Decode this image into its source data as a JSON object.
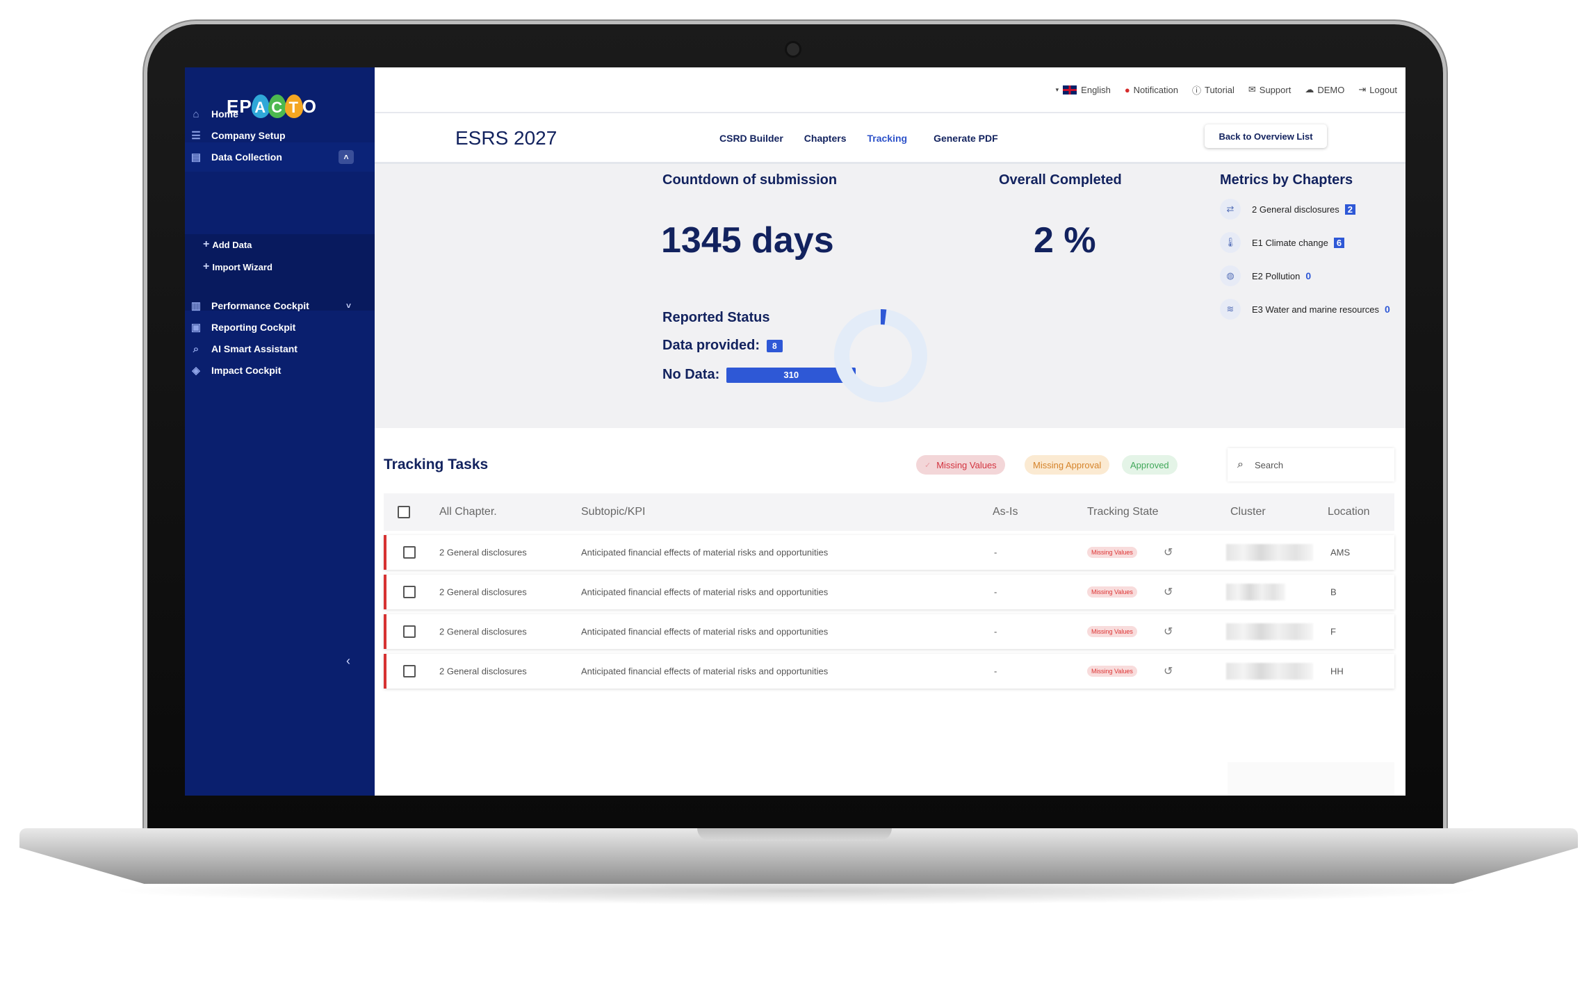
{
  "app": {
    "logo_text": "EPACTO",
    "logo_parts": [
      "EP",
      "A",
      "C",
      "T",
      "O"
    ],
    "colors": {
      "sidebar": "#0a1f6e",
      "accent": "#2e58d6",
      "missing": "#d3333f",
      "approval": "#d5832a",
      "approved": "#41a85a"
    }
  },
  "sidebar": {
    "items": [
      {
        "label": "Home",
        "icon": "home-icon"
      },
      {
        "label": "Company Setup",
        "icon": "list-icon"
      },
      {
        "label": "Data Collection",
        "icon": "database-icon"
      },
      {
        "label": "Performance Cockpit",
        "icon": "chart-icon"
      },
      {
        "label": "Reporting Cockpit",
        "icon": "document-icon"
      },
      {
        "label": "AI Smart Assistant",
        "icon": "search-icon"
      },
      {
        "label": "Impact Cockpit",
        "icon": "layers-icon"
      }
    ],
    "sub_items": [
      {
        "label": "Add Data"
      },
      {
        "label": "Import Wizard"
      }
    ],
    "collapse_glyph": "‹"
  },
  "topbar": {
    "language": "English",
    "notification": "Notification",
    "tutorial": "Tutorial",
    "support": "Support",
    "user": "DEMO",
    "logout": "Logout"
  },
  "header": {
    "title": "ESRS 2027",
    "tabs": [
      {
        "label": "CSRD Builder"
      },
      {
        "label": "Chapters"
      },
      {
        "label": "Tracking",
        "active": true
      },
      {
        "label": "Generate PDF"
      }
    ],
    "back_button": "Back to Overview List"
  },
  "summary": {
    "countdown_title": "Countdown of submission",
    "countdown_value": "1345 days",
    "reported_title": "Reported Status",
    "data_provided_label": "Data provided:",
    "data_provided_count": "8",
    "no_data_label": "No Data:",
    "no_data_count": "310",
    "overall_title": "Overall Completed",
    "overall_value": "2 %",
    "overall_fraction": 0.02,
    "metrics_title": "Metrics by Chapters",
    "metrics": [
      {
        "label": "2 General disclosures",
        "count": "2",
        "icon": "exchange-icon"
      },
      {
        "label": "E1 Climate change",
        "count": "6",
        "icon": "thermometer-icon"
      },
      {
        "label": "E2 Pollution",
        "count": "0",
        "icon": "globe-icon"
      },
      {
        "label": "E3 Water and marine resources",
        "count": "0",
        "icon": "water-icon"
      }
    ]
  },
  "tasks": {
    "title": "Tracking Tasks",
    "filters": {
      "missing_values": "Missing Values",
      "missing_approval": "Missing Approval",
      "approved": "Approved"
    },
    "search_placeholder": "Search",
    "columns": {
      "chapter": "All Chapter.",
      "subtopic": "Subtopic/KPI",
      "as_is": "As-Is",
      "tracking_state": "Tracking State",
      "cluster": "Cluster",
      "location": "Location"
    },
    "rows": [
      {
        "chapter": "2 General disclosures",
        "subtopic": "Anticipated financial effects of material risks and opportunities",
        "as_is": "-",
        "state": "Missing Values",
        "location": "AMS"
      },
      {
        "chapter": "2 General disclosures",
        "subtopic": "Anticipated financial effects of material risks and opportunities",
        "as_is": "-",
        "state": "Missing Values",
        "location": "B"
      },
      {
        "chapter": "2 General disclosures",
        "subtopic": "Anticipated financial effects of material risks and opportunities",
        "as_is": "-",
        "state": "Missing Values",
        "location": "F"
      },
      {
        "chapter": "2 General disclosures",
        "subtopic": "Anticipated financial effects of material risks and opportunities",
        "as_is": "-",
        "state": "Missing Values",
        "location": "HH"
      }
    ]
  }
}
